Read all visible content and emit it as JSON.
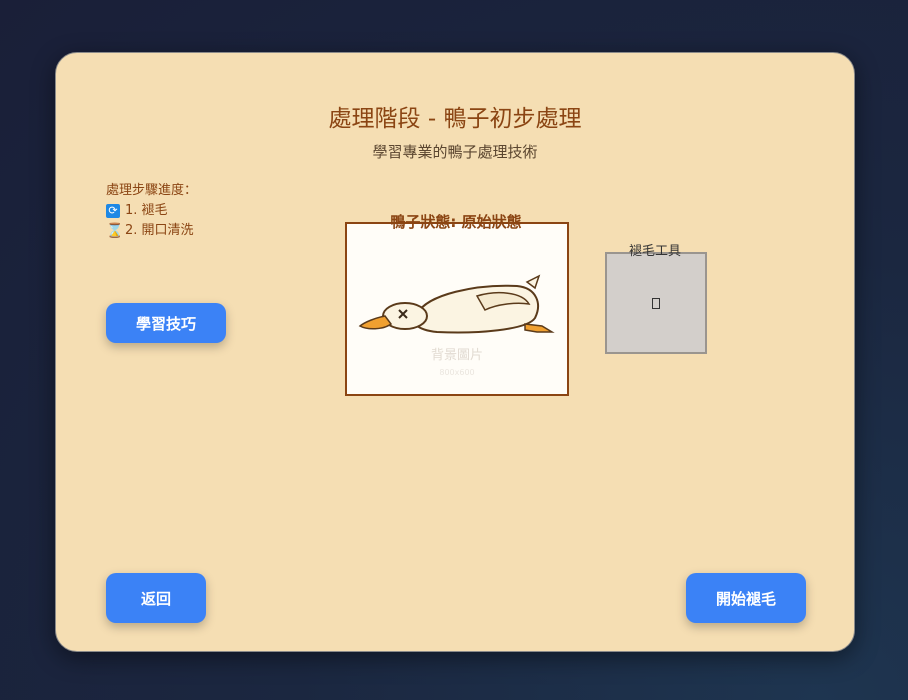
{
  "header": {
    "title": "處理階段 - 鴨子初步處理",
    "subtitle": "學習專業的鴨子處理技術"
  },
  "steps": {
    "heading": "處理步驟進度：",
    "items": [
      {
        "label": "1. 褪毛",
        "icon": "refresh-icon",
        "state": "in-progress"
      },
      {
        "label": "2. 開口清洗",
        "icon": "hourglass-icon",
        "state": "pending"
      }
    ]
  },
  "buttons": {
    "tips": "學習技巧",
    "back": "返回",
    "start": "開始褪毛"
  },
  "duck": {
    "status": "鴨子狀態: 原始狀態",
    "background_label": "背景圖片",
    "background_size": "800x600"
  },
  "tool": {
    "label": "褪毛工具"
  },
  "colors": {
    "panel": "#f5deb3",
    "accent": "#3b82f6",
    "title": "#8b4513"
  }
}
